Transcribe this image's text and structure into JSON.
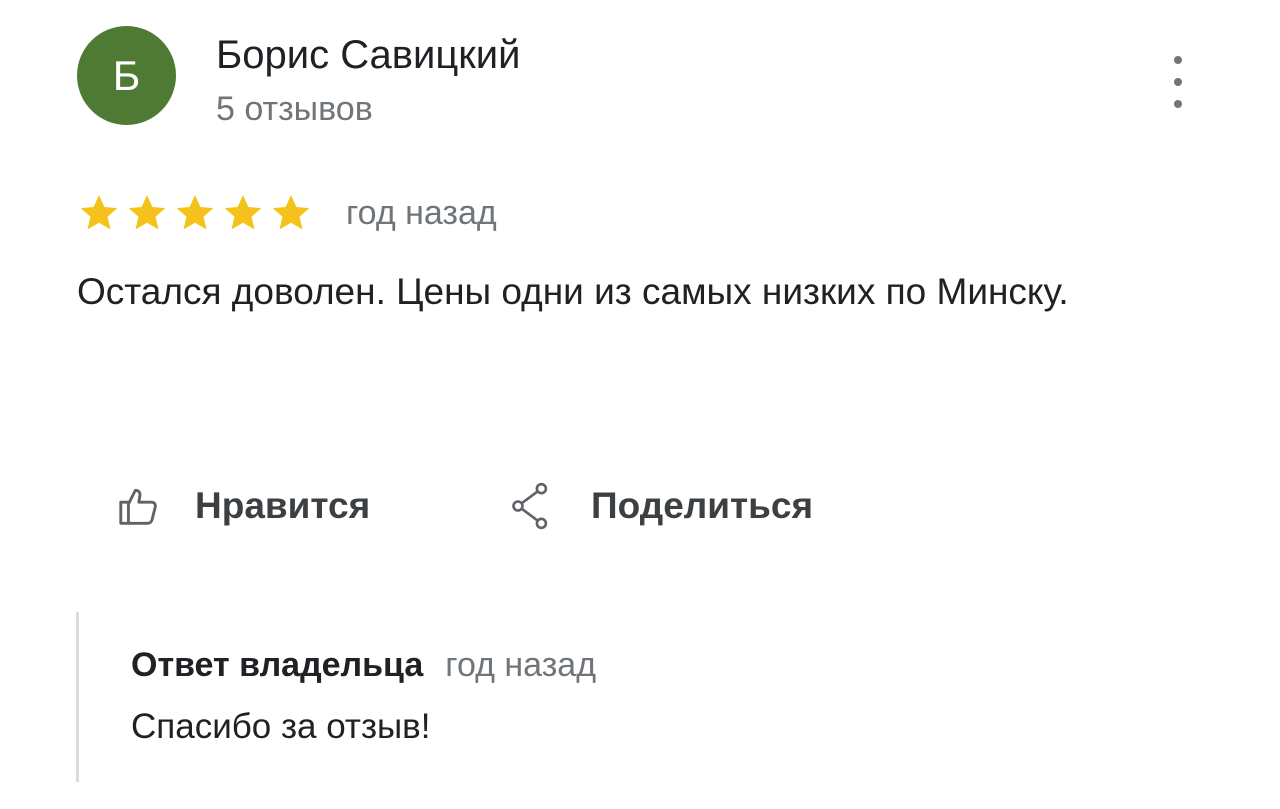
{
  "review": {
    "author": {
      "avatar_letter": "Б",
      "avatar_color": "#4e7a34",
      "name": "Борис Савицкий",
      "reviews_count": "5 отзывов"
    },
    "menu_icon": "more-vert-icon",
    "rating": {
      "stars": 5,
      "max": 5,
      "star_color": "#f4c21b"
    },
    "time": "год назад",
    "text": "Остался доволен. Цены одни из самых низких по Минску.",
    "actions": {
      "like": {
        "icon": "thumb-up-icon",
        "label": "Нравится"
      },
      "share": {
        "icon": "share-icon",
        "label": "Поделиться"
      }
    }
  },
  "owner_reply": {
    "title": "Ответ владельца",
    "time": "год назад",
    "text": "Спасибо за отзыв!"
  }
}
